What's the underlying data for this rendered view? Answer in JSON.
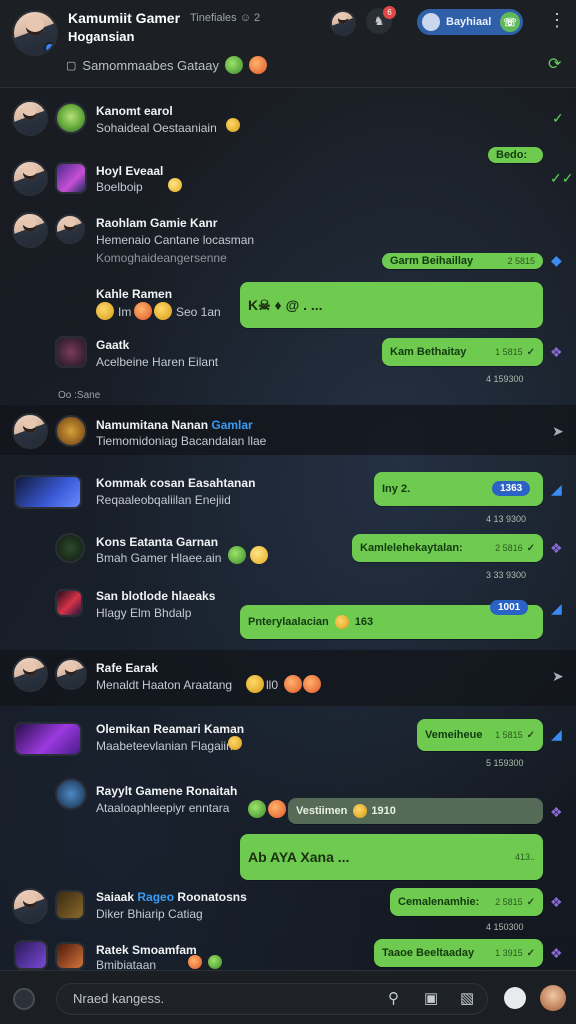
{
  "header": {
    "title": "Kamumiit Gamer",
    "subtitle": "Hogansian",
    "meta": "Tinefiales ☺ 2",
    "pill_label": "Bayhiaal",
    "status": "Samommaabes Gataay",
    "notif_count": "6"
  },
  "chats": [
    {
      "name": "Kanomt earol",
      "preview": "Sohaideal Oestaaniain",
      "bubble": "Bedo:"
    },
    {
      "name": "Hoyl Eveaal",
      "preview": "Boelboip"
    },
    {
      "name": "Raohlam Gamie Kanr",
      "preview": "Hemenaio Cantane locasman",
      "preview2": "Komoghaideangersenne",
      "bubble": "Garm Beihaillay",
      "time": "2 5815"
    },
    {
      "name": "Kahle Ramen",
      "preview": "Im",
      "preview_num": "Seo 1an",
      "bubble": "K☠ ♦ @ . ..."
    },
    {
      "name": "Gaatk",
      "preview": "Acelbeine Haren Eilant",
      "bubble": "Kam Bethaitay",
      "time": "1 5815",
      "stamp": "4 159300"
    },
    {
      "divider": "Oo :Sane"
    },
    {
      "name": "Namumitana Nanan",
      "name_accent": "Gamlar",
      "preview": "Tiemomidoniag Bacandalan llae"
    },
    {
      "name": "Kommak cosan Easahtanan",
      "preview": "Reqaaleobqaliilan Enejiid",
      "bubble": "Iny 2.",
      "badge": "1363",
      "stamp": "4 13 9300"
    },
    {
      "name": "Kons Eatanta Garnan",
      "preview": "Bmah Gamer Hlaee.ain",
      "bubble": "Kamlelehekaytalan:",
      "time": "2 5816",
      "stamp": "3 33 9300"
    },
    {
      "name": "San blotlode hlaeaks",
      "preview": "Hlagy Elm Bhdalp",
      "bubble": "Pnterylaalacian",
      "bubble_num": "163",
      "badge": "1001"
    },
    {
      "name": "Rafe Earak",
      "preview": "Menaldt Haaton Araatang",
      "preview_num": "ll0"
    },
    {
      "name": "Olemikan Reamari Kaman",
      "preview": "Maabeteevlanian Flagaiin",
      "bubble": "Vemeiheue",
      "time": "1 5815",
      "stamp": "5 159300"
    },
    {
      "name": "Rayylt Gamene Ronaitah",
      "preview": "Ataaloaphleepiyr enntara",
      "bubble": "Vestiimen",
      "bubble_num": "1910"
    },
    {
      "bubble": "Ab AYA Xana ...",
      "time": "413.."
    },
    {
      "name": "Saiaak",
      "name_accent": "Rageo",
      "name_tail": "Roonatosns",
      "preview": "Diker Bhiarip Catiag",
      "bubble": "Cemalenamhie:",
      "time": "2 5815",
      "stamp": "4 150300"
    },
    {
      "name": "Ratek Smoamfam",
      "preview": "Bmibiataan",
      "bubble": "Taaoe Beeltaaday",
      "time": "1 3915"
    }
  ],
  "composer": {
    "placeholder": "Nraed kangess."
  },
  "colors": {
    "bubble": "#6fcb4f",
    "header": "#1c1f24",
    "accent_blue": "#3b82f6",
    "bg": "#15181d"
  }
}
